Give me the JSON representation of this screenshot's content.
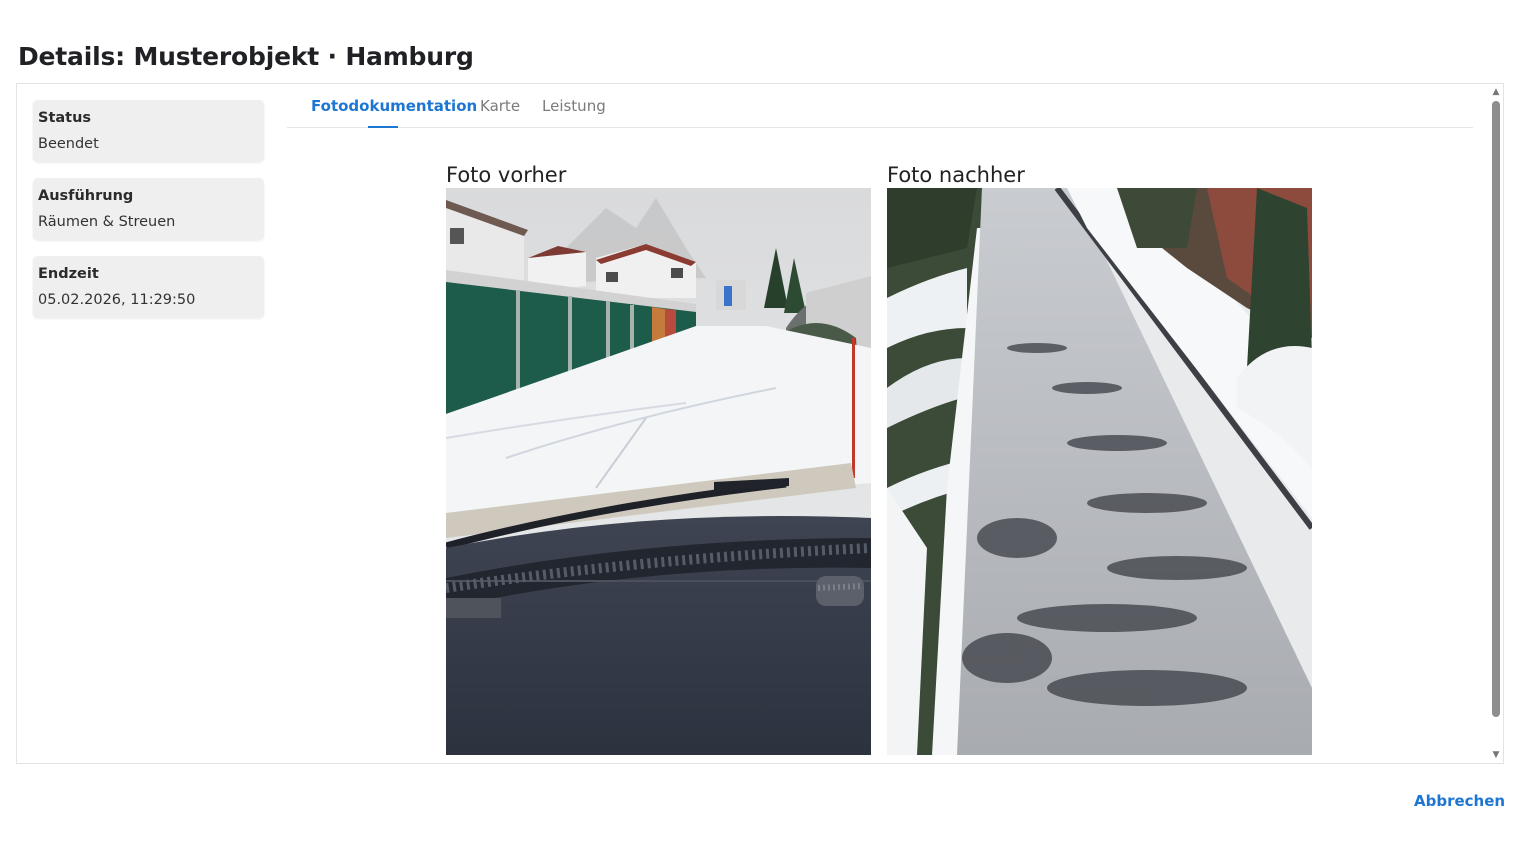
{
  "dialog": {
    "title": "Details: Musterobjekt · Hamburg",
    "cancel_label": "Abbrechen"
  },
  "sidebar": {
    "cards": [
      {
        "label": "Status",
        "value": "Beendet"
      },
      {
        "label": "Ausführung",
        "value": "Räumen & Streuen"
      },
      {
        "label": "Endzeit",
        "value": "05.02.2026, 11:29:50"
      }
    ]
  },
  "tabs": [
    {
      "label": "Fotodokumentation",
      "active": true
    },
    {
      "label": "Karte",
      "active": false
    },
    {
      "label": "Leistung",
      "active": false
    }
  ],
  "photos": {
    "before_title": "Foto vorher",
    "after_title": "Foto nachher"
  },
  "colors": {
    "accent": "#1e76d3",
    "card_bg": "#efefef"
  }
}
